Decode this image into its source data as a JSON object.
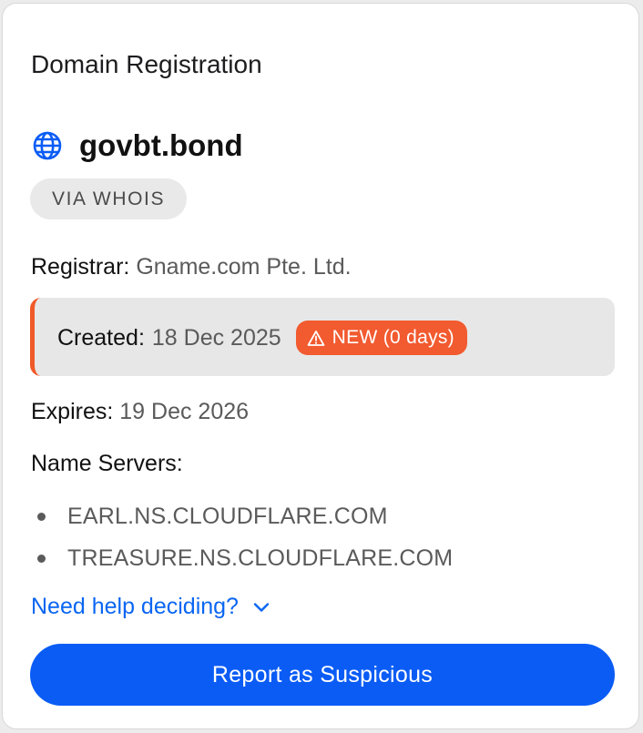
{
  "card": {
    "title": "Domain Registration",
    "domain": "govbt.bond",
    "domain_icon": "globe-icon",
    "source_chip": "VIA WHOIS"
  },
  "registrar": {
    "label": "Registrar:",
    "value": "Gname.com Pte. Ltd."
  },
  "created": {
    "label": "Created:",
    "value": "18 Dec 2025",
    "badge": "NEW (0 days)",
    "badge_icon": "warning-triangle-icon",
    "accent_color": "#f05a28"
  },
  "expires": {
    "label": "Expires:",
    "value": "19 Dec 2026"
  },
  "name_servers": {
    "label": "Name Servers:",
    "items": [
      "EARL.NS.CLOUDFLARE.COM",
      "TREASURE.NS.CLOUDFLARE.COM"
    ]
  },
  "help": {
    "label": "Need help deciding?",
    "icon": "chevron-down-icon"
  },
  "actions": {
    "report_label": "Report as Suspicious",
    "primary_color": "#0a5cf5"
  }
}
